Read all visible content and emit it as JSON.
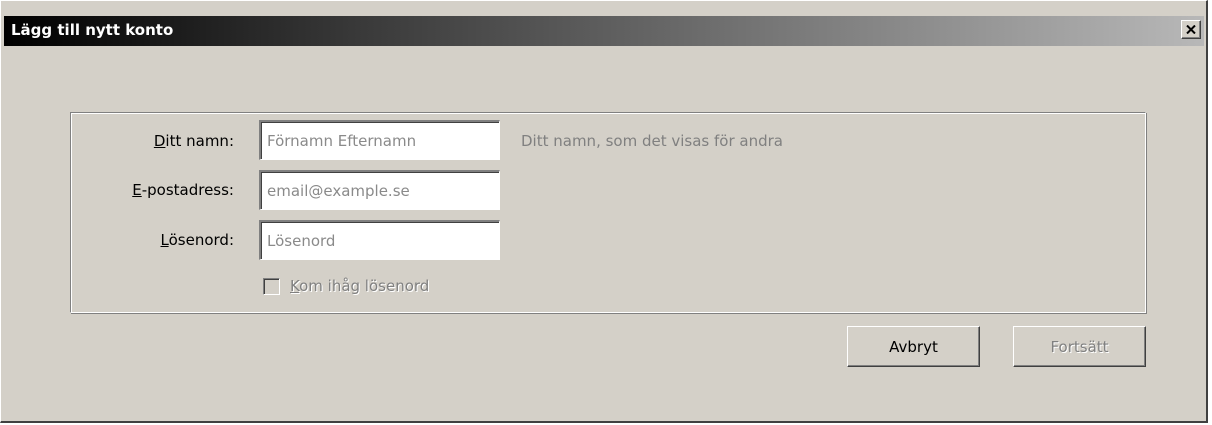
{
  "window": {
    "title": "Lägg till nytt konto"
  },
  "form": {
    "name": {
      "label": "Ditt namn:",
      "placeholder": "Förnamn Efternamn",
      "value": "",
      "hint": "Ditt namn, som det visas för andra"
    },
    "email": {
      "label": "E-postadress:",
      "placeholder": "email@example.se",
      "value": ""
    },
    "password": {
      "label": "Lösenord:",
      "placeholder": "Lösenord",
      "value": ""
    },
    "remember_password": {
      "label": "Kom ihåg lösenord",
      "checked": false,
      "enabled": false
    }
  },
  "buttons": {
    "cancel_label": "Avbryt",
    "continue_label": "Fortsätt",
    "continue_enabled": false
  },
  "icons": {
    "close": "close-icon"
  },
  "colors": {
    "dialog_background": "#d4d0c8",
    "titlebar_start": "#000000",
    "titlebar_end": "#b8b8b8",
    "disabled_text": "#808080"
  }
}
